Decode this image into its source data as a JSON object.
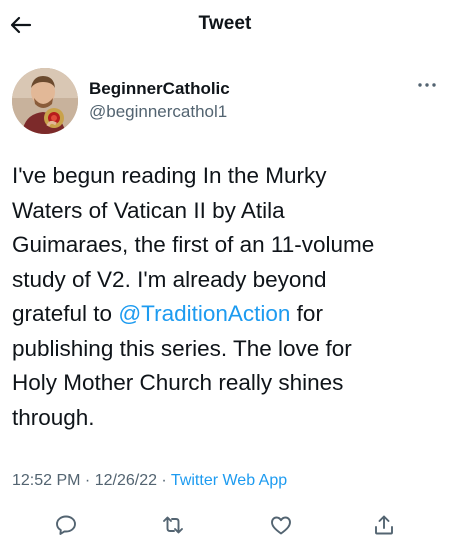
{
  "header": {
    "title": "Tweet",
    "back_icon": "arrow-left-icon"
  },
  "author": {
    "display_name": "BeginnerCatholic",
    "handle": "@beginnercathol1",
    "more_icon": "more-horizontal-icon"
  },
  "tweet": {
    "lines": [
      {
        "text": "I've begun reading In the Murky"
      },
      {
        "text": "Waters of Vatican II by Atila"
      },
      {
        "text": "Guimaraes, the first of an 11-volume"
      },
      {
        "text": "study of V2. I'm already beyond"
      },
      {
        "before": "grateful to ",
        "mention": "@TraditionAction",
        "after": " for"
      },
      {
        "text": "publishing this series. The love for"
      },
      {
        "text": "Holy Mother Church really shines"
      },
      {
        "text": "through."
      }
    ]
  },
  "meta": {
    "time": "12:52 PM",
    "separator": " · ",
    "date": "12/26/22",
    "source": "Twitter Web App"
  },
  "actions": {
    "reply_icon": "reply-icon",
    "retweet_icon": "retweet-icon",
    "like_icon": "heart-icon",
    "share_icon": "share-icon"
  },
  "colors": {
    "text": "#0f1419",
    "secondary": "#536471",
    "link": "#1d9bf0"
  }
}
